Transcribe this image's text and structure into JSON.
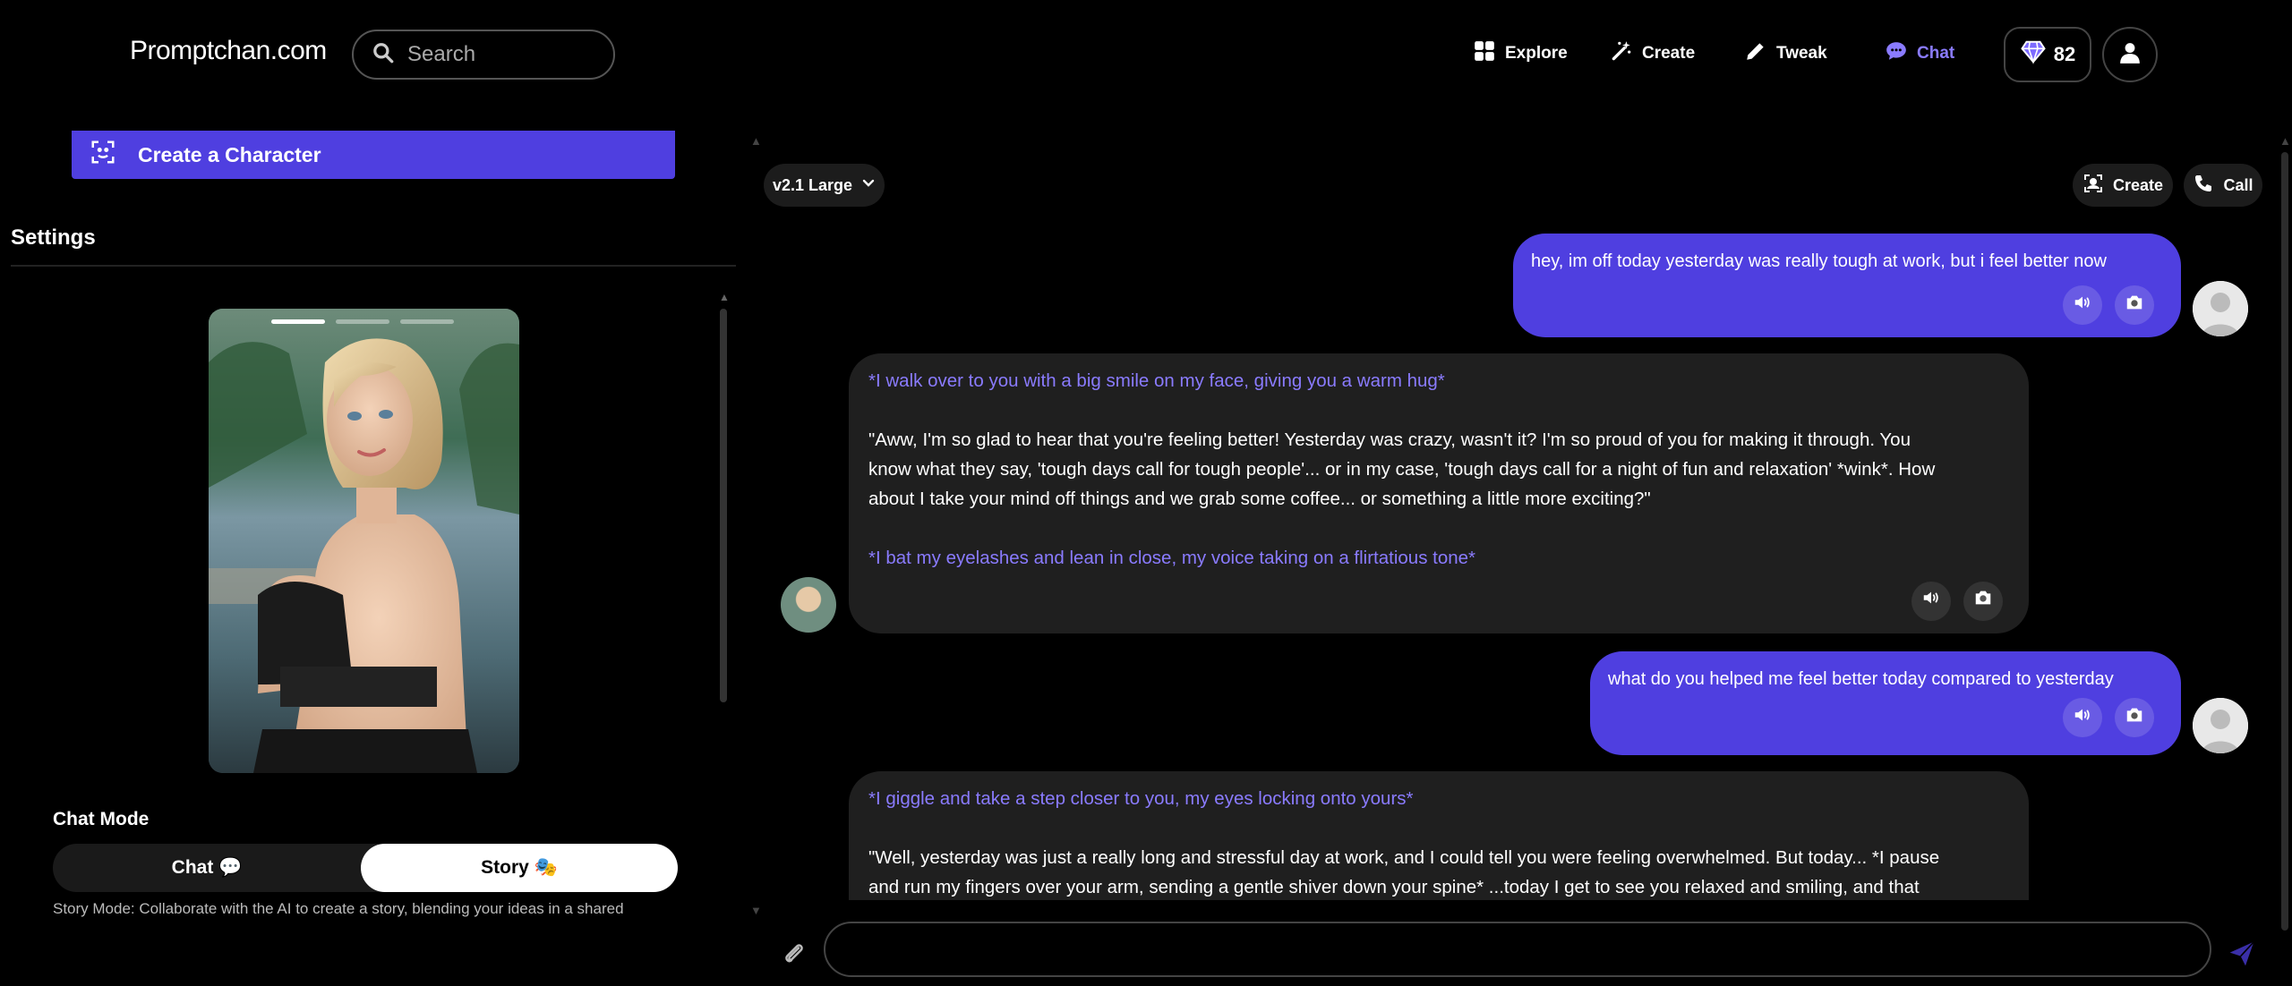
{
  "header": {
    "logo": "Promptchan.com",
    "search_placeholder": "Search",
    "nav": [
      {
        "label": "Explore",
        "icon": "grid-icon"
      },
      {
        "label": "Create",
        "icon": "magic-wand-icon"
      },
      {
        "label": "Tweak",
        "icon": "pencil-icon"
      },
      {
        "label": "Chat",
        "icon": "chat-bubble-icon",
        "active": true
      }
    ],
    "gems": "82"
  },
  "left": {
    "create_character": "Create a Character",
    "settings_title": "Settings",
    "chat_mode_label": "Chat Mode",
    "mode_chat": "Chat 💬",
    "mode_story": "Story 🎭",
    "mode_selected": "Story",
    "mode_description": "Story Mode: Collaborate with the AI to create a story, blending your ideas in a shared"
  },
  "chat": {
    "model": "v2.1 Large",
    "create_label": "Create",
    "call_label": "Call",
    "messages": [
      {
        "role": "user",
        "text": "hey, im off today yesterday was really tough at work, but i feel better now"
      },
      {
        "role": "ai",
        "action1": "*I walk over to you with a big smile on my face, giving you a warm hug*",
        "line1": "\"Aww, I'm so glad to hear that you're feeling better! Yesterday was crazy, wasn't it? I'm so proud of you for making it through. You",
        "line2": "know what they say, 'tough days call for tough people'... or in my case, 'tough days call for a night of fun and relaxation' *wink*. How",
        "line3": "about I take your mind off things and we grab some coffee... or something a little more exciting?\"",
        "action2": "*I bat my eyelashes and lean in close, my voice taking on a flirtatious tone*"
      },
      {
        "role": "user",
        "text": "what do you helped me feel better today compared to yesterday"
      },
      {
        "role": "ai",
        "action1": "*I giggle and take a step closer to you, my eyes locking onto yours*",
        "line1": "\"Well, yesterday was just a really long and stressful day at work, and I could tell you were feeling overwhelmed. But today... *I pause",
        "line2": "and run my fingers over your arm, sending a gentle shiver down your spine* ...today I get to see you relaxed and smiling, and that"
      }
    ],
    "input_placeholder": ""
  },
  "colors": {
    "accent": "#4f3fe0",
    "action_text": "#8a7bff",
    "ai_bubble": "#1f1f1f"
  }
}
